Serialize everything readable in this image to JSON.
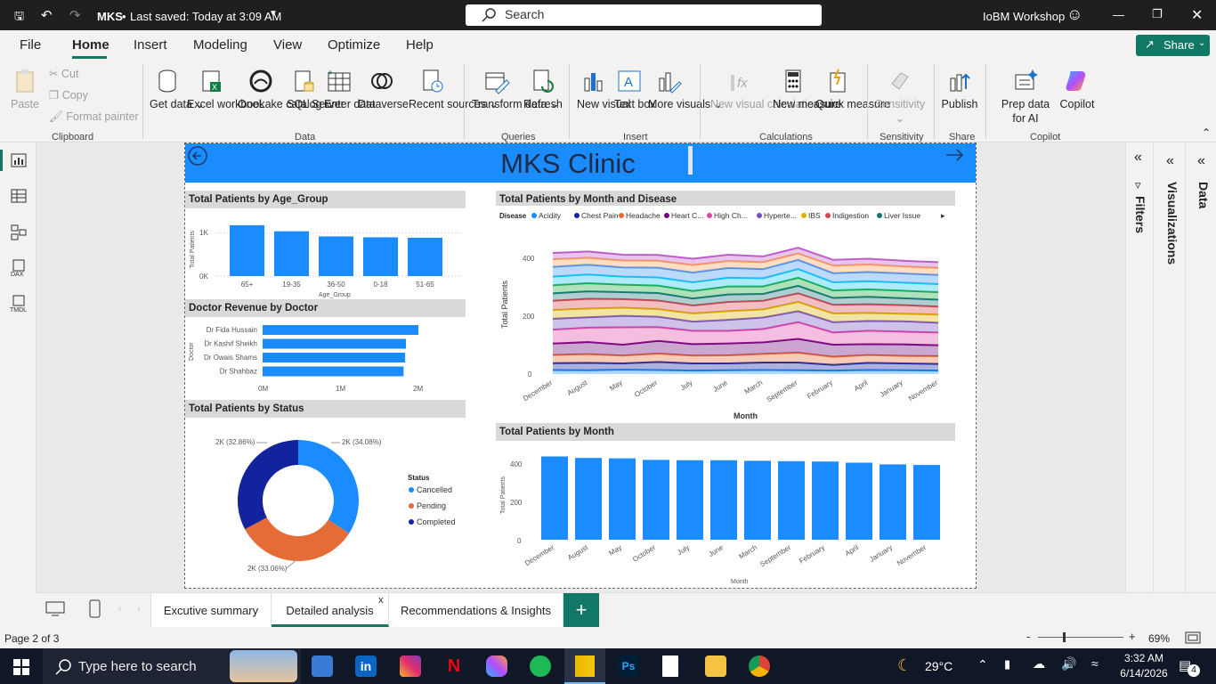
{
  "titlebar": {
    "doc": "MKS",
    "saved": "Last saved: Today at 3:09 AM",
    "search": "Search",
    "workspace": "IoBM Workshop"
  },
  "menu": [
    "File",
    "Home",
    "Insert",
    "Modeling",
    "View",
    "Optimize",
    "Help"
  ],
  "share": "Share",
  "ribbon": {
    "clipboard": {
      "paste": "Paste",
      "cut": "Cut",
      "copy": "Copy",
      "format": "Format painter",
      "group": "Clipboard"
    },
    "data": {
      "get": "Get data",
      "excel": "Excel workbook",
      "onelake": "OneLake catalog",
      "sql": "SQL Server",
      "enter": "Enter data",
      "dataverse": "Dataverse",
      "recent": "Recent sources",
      "group": "Data"
    },
    "queries": {
      "transform": "Transform data",
      "refresh": "Refresh",
      "group": "Queries"
    },
    "insert": {
      "visual": "New visual",
      "text": "Text box",
      "more": "More visuals",
      "group": "Insert"
    },
    "calc": {
      "newcalc": "New visual calculation",
      "measure": "New measure",
      "quick": "Quick measure",
      "group": "Calculations"
    },
    "sens": {
      "label": "Sensitivity",
      "group": "Sensitivity"
    },
    "share": {
      "publish": "Publish",
      "group": "Share"
    },
    "copilot": {
      "prep": "Prep data for AI",
      "copilot": "Copilot",
      "group": "Copilot"
    }
  },
  "report": {
    "title": "MKS Clinic"
  },
  "age_chart": {
    "title": "Total Patients by Age_Group",
    "ylabel": "Total Patients",
    "xlabel": "Age_Group",
    "yticks": [
      "1K",
      "0K"
    ]
  },
  "doctor_chart": {
    "title": "Doctor Revenue by Doctor",
    "ylabel": "Doctor",
    "xticks": [
      "0M",
      "1M",
      "2M"
    ]
  },
  "status_chart": {
    "title": "Total Patients by Status",
    "legend_title": "Status",
    "labels": [
      "2K (34.08%)",
      "2K (33.06%)",
      "2K (32.86%)"
    ]
  },
  "disease_chart": {
    "title": "Total Patients by Month and Disease",
    "legend_title": "Disease",
    "xlabel": "Month",
    "ylabel": "Total Patients",
    "yticks": [
      "400",
      "200",
      "0"
    ]
  },
  "month_chart": {
    "title": "Total Patients by Month",
    "xlabel": "Month",
    "ylabel": "Total Patients",
    "yticks": [
      "400",
      "200",
      "0"
    ]
  },
  "chart_data": [
    {
      "type": "bar",
      "title": "Total Patients by Age_Group",
      "categories": [
        "65+",
        "19-35",
        "36-50",
        "0-18",
        "51-65"
      ],
      "values": [
        1180,
        1040,
        920,
        900,
        890
      ],
      "xlabel": "Age_Group",
      "ylabel": "Total Patients",
      "ylim": [
        0,
        1300
      ],
      "color": "#1a8cff"
    },
    {
      "type": "bar",
      "orientation": "horizontal",
      "title": "Doctor Revenue by Doctor",
      "categories": [
        "Dr Fida Hussain",
        "Dr Kashif Sheikh",
        "Dr Owais Shams",
        "Dr Shahbaz"
      ],
      "values": [
        2000000,
        1840000,
        1830000,
        1810000
      ],
      "ylabel": "Doctor",
      "xlim": [
        0,
        2000000
      ],
      "color": "#1a8cff"
    },
    {
      "type": "pie",
      "donut": true,
      "title": "Total Patients by Status",
      "categories": [
        "Cancelled",
        "Pending",
        "Completed"
      ],
      "values": [
        34.08,
        33.06,
        32.86
      ],
      "colors": [
        "#1a8cff",
        "#e66c37",
        "#12239e"
      ]
    },
    {
      "type": "area",
      "stacked": true,
      "title": "Total Patients by Month and Disease",
      "x": [
        "December",
        "August",
        "May",
        "October",
        "July",
        "June",
        "March",
        "September",
        "February",
        "April",
        "January",
        "November"
      ],
      "series": [
        {
          "name": "Acidity",
          "color": "#1a8cff",
          "values": [
            14,
            13,
            15,
            14,
            12,
            13,
            14,
            13,
            12,
            14,
            13,
            12
          ]
        },
        {
          "name": "Chest Pain",
          "color": "#12239e",
          "values": [
            24,
            26,
            22,
            28,
            25,
            24,
            26,
            27,
            20,
            25,
            24,
            23
          ]
        },
        {
          "name": "Headache",
          "color": "#e66c37",
          "values": [
            28,
            30,
            27,
            29,
            27,
            28,
            30,
            34,
            28,
            27,
            26,
            27
          ]
        },
        {
          "name": "Heart C...",
          "color": "#6b007b",
          "values": [
            40,
            42,
            38,
            44,
            40,
            41,
            40,
            48,
            42,
            38,
            40,
            38
          ]
        },
        {
          "name": "High Ch...",
          "color": "#e044a7",
          "values": [
            48,
            50,
            60,
            48,
            46,
            44,
            46,
            58,
            42,
            46,
            44,
            44
          ]
        },
        {
          "name": "Hyperte...",
          "color": "#744ec2",
          "values": [
            38,
            36,
            40,
            36,
            32,
            38,
            40,
            38,
            36,
            34,
            36,
            34
          ]
        },
        {
          "name": "IBS",
          "color": "#d9b300",
          "values": [
            30,
            30,
            28,
            26,
            28,
            30,
            28,
            32,
            30,
            28,
            26,
            28
          ]
        },
        {
          "name": "Indigestion",
          "color": "#d64550",
          "values": [
            32,
            34,
            30,
            30,
            28,
            32,
            30,
            30,
            30,
            30,
            30,
            28
          ]
        },
        {
          "name": "Liver Issue",
          "color": "#197278",
          "values": [
            26,
            26,
            24,
            26,
            24,
            26,
            24,
            26,
            24,
            26,
            24,
            24
          ]
        },
        {
          "name": "",
          "color": "#1aab40",
          "values": [
            28,
            28,
            26,
            26,
            26,
            28,
            26,
            28,
            26,
            26,
            26,
            26
          ]
        },
        {
          "name": "",
          "color": "#15c6f4",
          "values": [
            30,
            30,
            28,
            28,
            30,
            30,
            28,
            30,
            28,
            28,
            28,
            28
          ]
        },
        {
          "name": "",
          "color": "#4092ff",
          "values": [
            34,
            34,
            32,
            34,
            34,
            34,
            32,
            32,
            32,
            32,
            32,
            32
          ]
        },
        {
          "name": "",
          "color": "#ffa058",
          "values": [
            26,
            24,
            24,
            24,
            26,
            24,
            24,
            22,
            26,
            26,
            24,
            24
          ]
        },
        {
          "name": "",
          "color": "#be5dc9",
          "values": [
            22,
            22,
            20,
            20,
            22,
            22,
            20,
            20,
            20,
            20,
            20,
            20
          ]
        }
      ],
      "xlabel": "Month",
      "ylabel": "Total Patients",
      "ylim": [
        0,
        460
      ]
    },
    {
      "type": "bar",
      "title": "Total Patients by Month",
      "categories": [
        "December",
        "August",
        "May",
        "October",
        "July",
        "June",
        "March",
        "September",
        "February",
        "April",
        "January",
        "November"
      ],
      "values": [
        440,
        432,
        430,
        422,
        420,
        420,
        417,
        415,
        413,
        407,
        398,
        395
      ],
      "xlabel": "Month",
      "ylabel": "Total Patients",
      "ylim": [
        0,
        460
      ],
      "color": "#1a8cff"
    }
  ],
  "panes": {
    "filters": "Filters",
    "visualizations": "Visualizations",
    "data": "Data"
  },
  "tabs": [
    "Excutive summary",
    "Detailed analysis",
    "Recommendations & Insights"
  ],
  "status": {
    "page": "Page 2 of 3",
    "zoom": "69%"
  },
  "taskbar": {
    "search": "Type here to search",
    "temp": "29°C",
    "time": "3:32 AM",
    "date": "6/14/2026",
    "notif": "4"
  }
}
